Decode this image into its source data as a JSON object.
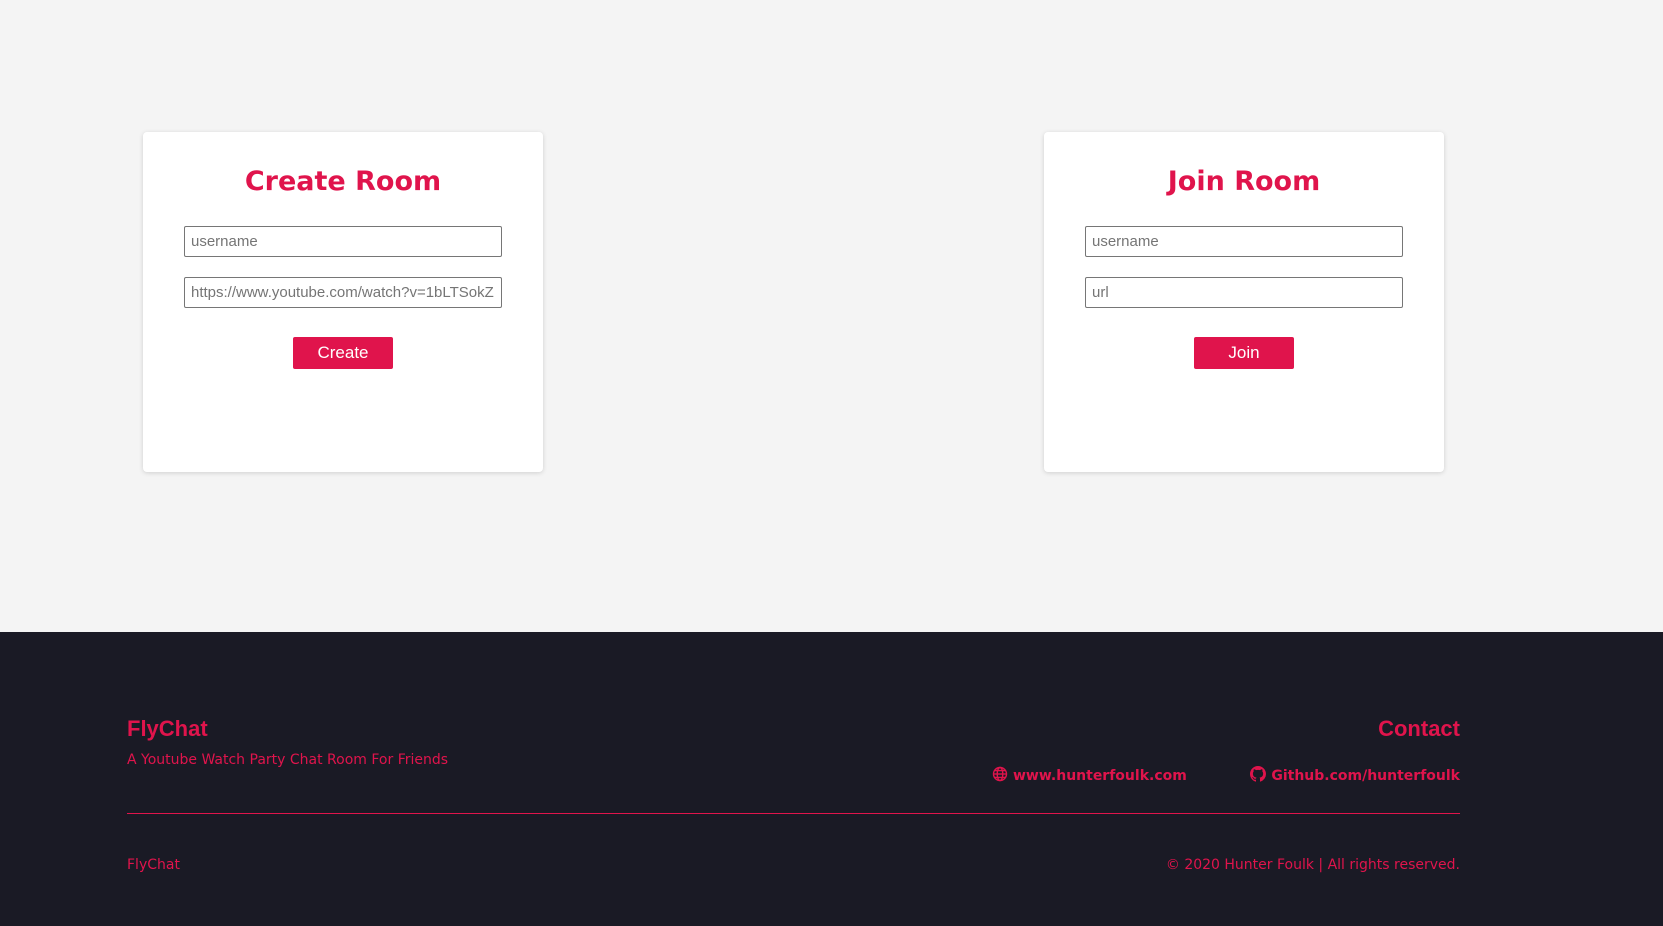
{
  "colors": {
    "accent": "#e0144c",
    "page_background": "#f4f4f4",
    "footer_background": "#1a1a25",
    "card_background": "#ffffff"
  },
  "create_room": {
    "title": "Create Room",
    "username_placeholder": "username",
    "url_value": "https://www.youtube.com/watch?v=1bLTSokZ",
    "button_label": "Create"
  },
  "join_room": {
    "title": "Join Room",
    "username_placeholder": "username",
    "url_placeholder": "url",
    "button_label": "Join"
  },
  "footer": {
    "brand": "FlyChat",
    "tagline": "A Youtube Watch Party Chat Room For Friends",
    "contact_title": "Contact",
    "website_link": "www.hunterfoulk.com",
    "website_icon": "globe-icon",
    "github_link": "Github.com/hunterfoulk",
    "github_icon": "github-icon",
    "bottom_brand": "FlyChat",
    "copyright": "© 2020 Hunter Foulk | All rights reserved."
  }
}
